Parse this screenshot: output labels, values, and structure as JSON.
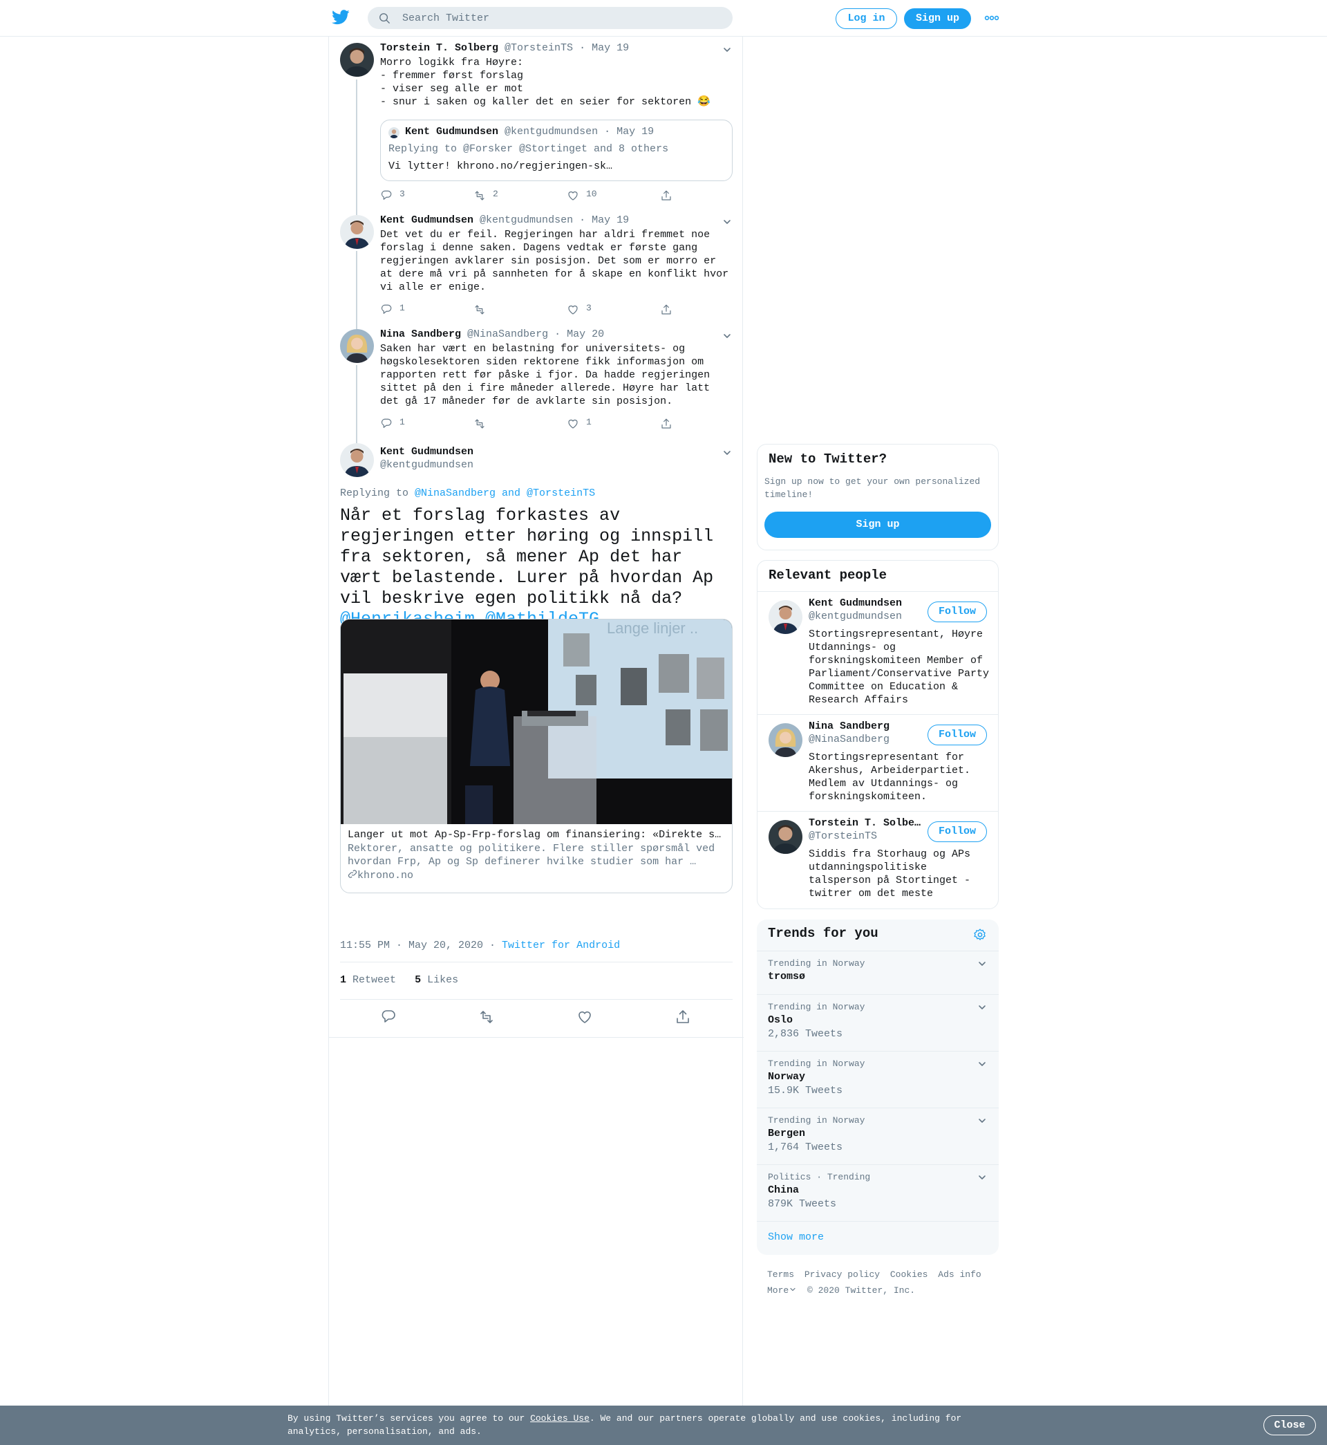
{
  "header": {
    "search_placeholder": "Search Twitter",
    "login_label": "Log in",
    "signup_label": "Sign up"
  },
  "tweets": [
    {
      "name": "Torstein T. Solberg",
      "handle": "@TorsteinTS",
      "date": "· May 19",
      "text": "Morro logikk fra Høyre:\n- fremmer først forslag\n- viser seg alle er mot\n- snur i saken og kaller det en seier for sektoren 😂",
      "quote": {
        "name": "Kent Gudmundsen",
        "handle": "@kentgudmundsen",
        "date": "· May 19",
        "replying": "Replying to @Forsker @Stortinget and 8 others",
        "text": "Vi lytter! khrono.no/regjeringen-sk…"
      },
      "replies": "3",
      "retweets": "2",
      "likes": "10"
    },
    {
      "name": "Kent Gudmundsen",
      "handle": "@kentgudmundsen",
      "date": "· May 19",
      "text": "Det vet du er feil. Regjeringen har aldri fremmet noe forslag i denne saken. Dagens vedtak er første gang regjeringen avklarer sin posisjon. Det som er morro er at dere må vri på sannheten for å skape en konflikt hvor vi alle er enige.",
      "replies": "1",
      "retweets": "",
      "likes": "3"
    },
    {
      "name": "Nina Sandberg",
      "handle": "@NinaSandberg",
      "date": "· May 20",
      "text": "Saken har vært en belastning for universitets- og høgskolesektoren siden rektorene fikk informasjon om rapporten rett før påske i fjor. Da hadde regjeringen sittet på den i fire måneder allerede. Høyre har latt det gå 17 måneder før de avklarte sin posisjon.",
      "replies": "1",
      "retweets": "",
      "likes": "1"
    }
  ],
  "focused": {
    "name": "Kent Gudmundsen",
    "handle": "@kentgudmundsen",
    "replying_prefix": "Replying to ",
    "replying_users": "@NinaSandberg and @TorsteinTS",
    "text": "Når et forslag forkastes av regjeringen etter høring og innspill fra sektoren, så mener Ap det har vært belastende. Lurer på hvordan Ap vil beskrive egen politikk nå da? ",
    "mentions": "@Henrikasheim @MathildeTG",
    "card": {
      "image_text": "Lange linjer ..",
      "title": "Langer ut mot Ap-Sp-Frp-forslag om finansiering: «Direkte s…",
      "description": "Rektorer, ansatte og politikere. Flere stiller spørsmål ved hvordan Frp, Ap og Sp definerer hvilke studier som har …",
      "domain": "khrono.no"
    },
    "time": "11:55 PM · May 20, 2020 · ",
    "source": "Twitter for Android",
    "retweet_count": "1",
    "retweet_label": "Retweet",
    "like_count": "5",
    "like_label": "Likes"
  },
  "sidebar": {
    "new_title": "New to Twitter?",
    "new_text": "Sign up now to get your own personalized timeline!",
    "new_signup": "Sign up",
    "relevant_title": "Relevant people",
    "people": [
      {
        "name": "Kent Gudmundsen",
        "handle": "@kentgudmundsen",
        "bio": "Stortingsrepresentant, Høyre Utdannings- og forskningskomiteen Member of Parliament/Conservative Party Committee on Education & Research Affairs",
        "follow": "Follow"
      },
      {
        "name": "Nina Sandberg",
        "handle": "@NinaSandberg",
        "bio": "Stortingsrepresentant for Akershus, Arbeiderpartiet. Medlem av Utdannings- og forskningskomiteen.",
        "follow": "Follow"
      },
      {
        "name": "Torstein T. Solberg",
        "handle": "@TorsteinTS",
        "bio": "Siddis fra Storhaug og APs utdanningspolitiske talsperson på Stortinget - twitrer om det meste",
        "follow": "Follow"
      }
    ],
    "trends_title": "Trends for you",
    "trends": [
      {
        "context": "Trending in Norway",
        "name": "tromsø",
        "count": ""
      },
      {
        "context": "Trending in Norway",
        "name": "Oslo",
        "count": "2,836 Tweets"
      },
      {
        "context": "Trending in Norway",
        "name": "Norway",
        "count": "15.9K Tweets"
      },
      {
        "context": "Trending in Norway",
        "name": "Bergen",
        "count": "1,764 Tweets"
      },
      {
        "context": "Politics · Trending",
        "name": "China",
        "count": "879K Tweets"
      }
    ],
    "show_more": "Show more"
  },
  "footer": {
    "links": [
      "Terms",
      "Privacy policy",
      "Cookies",
      "Ads info"
    ],
    "more": "More",
    "copyright": "© 2020 Twitter, Inc."
  },
  "cookie": {
    "text_before": "By using Twitter’s services you agree to our ",
    "link": "Cookies Use",
    "text_after": ". We and our partners operate globally and use cookies, including for analytics, personalisation, and ads.",
    "close": "Close"
  },
  "colors": {
    "brand": "#1da1f2",
    "secondary_text": "#657786",
    "border": "#e6ecf0",
    "cookie_bar": "#657786"
  }
}
